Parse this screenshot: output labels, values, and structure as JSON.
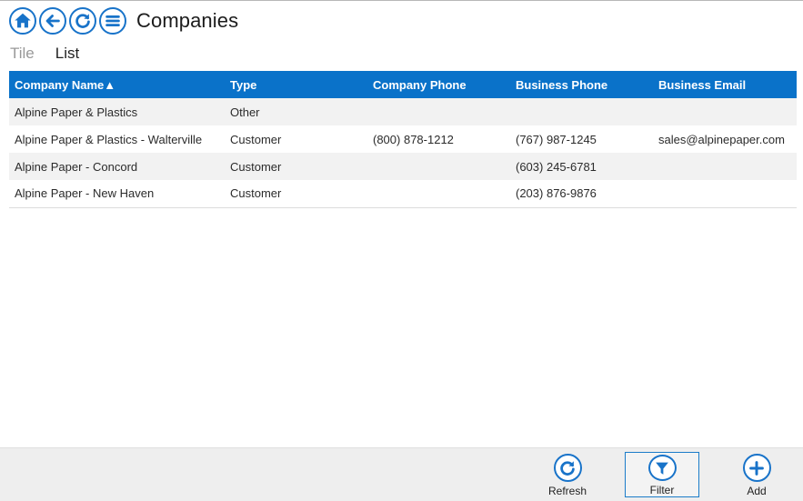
{
  "header": {
    "title": "Companies",
    "icons": [
      "home-icon",
      "back-arrow-icon",
      "refresh-icon",
      "menu-icon"
    ]
  },
  "views": {
    "tile": "Tile",
    "list": "List",
    "active": "List"
  },
  "table": {
    "columns": [
      "Company Name▲",
      "Type",
      "Company Phone",
      "Business Phone",
      "Business Email"
    ],
    "sort": {
      "column": "Company Name",
      "direction": "ascending"
    },
    "rows": [
      {
        "name": "Alpine Paper & Plastics",
        "type": "Other",
        "company_phone": "",
        "business_phone": "",
        "business_email": ""
      },
      {
        "name": "Alpine Paper & Plastics - Walterville",
        "type": "Customer",
        "company_phone": "(800) 878-1212",
        "business_phone": "(767) 987-1245",
        "business_email": "sales@alpinepaper.com"
      },
      {
        "name": "Alpine Paper - Concord",
        "type": "Customer",
        "company_phone": "",
        "business_phone": "(603) 245-6781",
        "business_email": ""
      },
      {
        "name": "Alpine Paper - New Haven",
        "type": "Customer",
        "company_phone": "",
        "business_phone": "(203) 876-9876",
        "business_email": ""
      }
    ]
  },
  "footer": {
    "refresh_label": "Refresh",
    "filter_label": "Filter",
    "add_label": "Add",
    "selected": "Filter"
  },
  "colors": {
    "accent": "#1873c9",
    "header_bg": "#0a72c9",
    "link": "#2f6fb3",
    "row_alt": "#f2f2f2",
    "footer_bg": "#eeeeee"
  }
}
